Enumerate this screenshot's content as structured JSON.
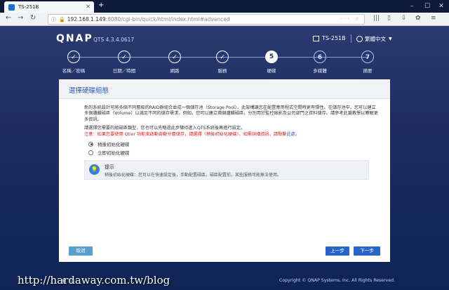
{
  "browser": {
    "tab_title": "TS-251B",
    "new_tab": "+",
    "url_host": "192.168.1.149",
    "url_rest": ":8080/cgi-bin/quick/html/index.html#advanced"
  },
  "header": {
    "logo": "QNAP",
    "version": "QTS 4.3.4.0617",
    "model": "TS-251B",
    "language": "繁體中文"
  },
  "steps": [
    {
      "num": "✓",
      "label": "名稱／密碼",
      "state": "done"
    },
    {
      "num": "✓",
      "label": "日期／時間",
      "state": "done"
    },
    {
      "num": "✓",
      "label": "網路",
      "state": "done"
    },
    {
      "num": "✓",
      "label": "服務",
      "state": "done"
    },
    {
      "num": "5",
      "label": "硬碟",
      "state": "active"
    },
    {
      "num": "6",
      "label": "多媒體",
      "state": "future"
    },
    {
      "num": "7",
      "label": "摘要",
      "state": "future"
    }
  ],
  "panel": {
    "title": "選擇硬碟組態",
    "description": "新的系統設計可將多個不同層級的RAID群組合並成一個儲存池（Storage Pool），此架構讓您在配置應用程式空間時更有彈性。在儲存池中，您可以建立多個邏輯磁區（Volume）以滿足不同的儲存需求，例如，您可以建立兩個邏輯磁區，分別用於監控錄影及公司部門之資料儲存。請參考此篇教學以瞭解更多資訊。",
    "prompt": "請選擇您需要的組磁區類型，您也可以先略過此步驟待進入QTS系統後再進行設定。",
    "note_prefix": "注意：如果您要使用 Qtier 功能來啟動自動分層儲存，請選擇〈稍後初始化硬碟〉，如需詳細資訊，請點擊",
    "note_link": "此處",
    "note_suffix": "。",
    "options": [
      "稍後初始化硬碟",
      "立即初始化硬碟"
    ],
    "tip_title": "提示",
    "tip_text": "稍後初始化硬碟：您可以在快速設定後，手動配置磁區。磁區配置前，某些服務可能無法使用。",
    "cancel": "取消",
    "prev": "上一步",
    "next": "下一步"
  },
  "footer": {
    "copyright": "Copyright © QNAP Systems, Inc. All Rights Reserved.",
    "watermark": "http://hardaway.com.tw/blog"
  }
}
